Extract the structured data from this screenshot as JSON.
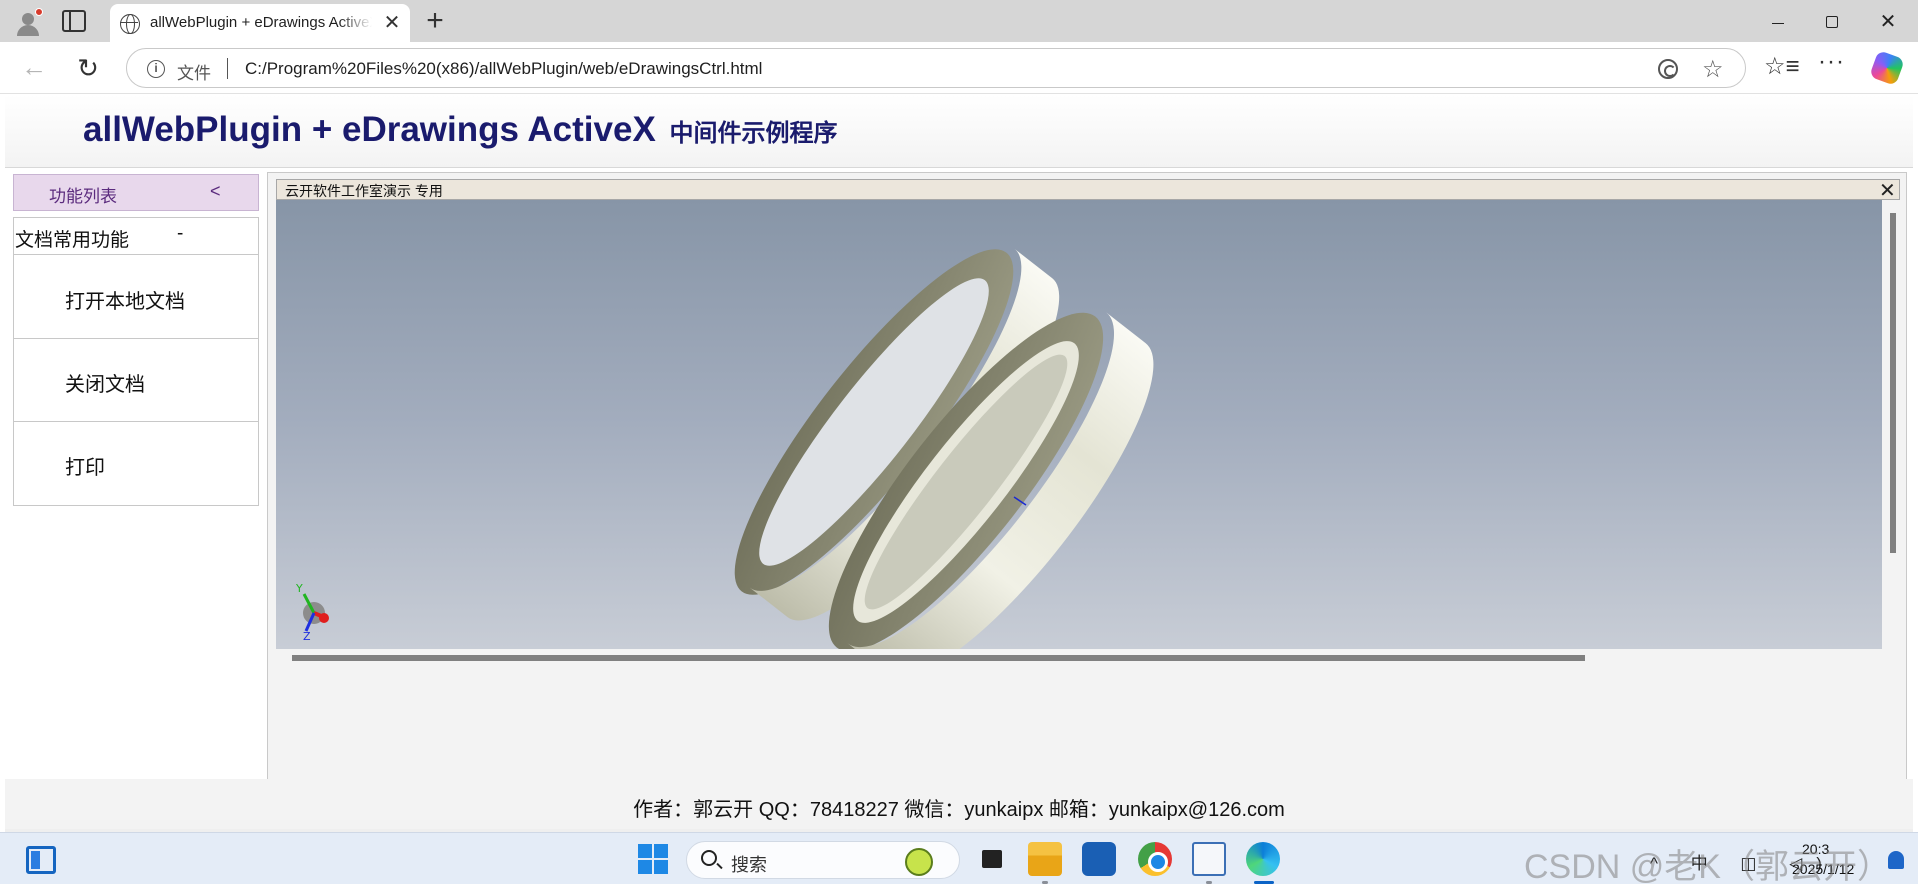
{
  "browser": {
    "tab_title": "allWebPlugin + eDrawings ActiveX",
    "tab_close": "✕",
    "new_tab": "+",
    "window": {
      "close": "✕"
    },
    "site_info_label": "文件",
    "url": "C:/Program%20Files%20(x86)/allWebPlugin/web/eDrawingsCtrl.html",
    "icons": [
      "back-arrow-icon",
      "reload-icon",
      "info-icon",
      "read-aloud-icon",
      "star-icon",
      "favorites-icon",
      "more-icon",
      "copilot-icon"
    ],
    "glyphs": {
      "back": "←",
      "reload": "↻",
      "info": "i",
      "star": "☆",
      "favorites": "☆≡",
      "menu": "···"
    }
  },
  "page": {
    "title": "allWebPlugin + eDrawings ActiveX",
    "subtitle": "中间件示例程序",
    "sidebar": {
      "title": "功能列表",
      "collapse_symbol": "<",
      "group": {
        "title": "文档常用功能",
        "toggle_symbol": "-",
        "items": [
          {
            "label": "打开本地文档"
          },
          {
            "label": "关闭文档"
          },
          {
            "label": "打印"
          }
        ]
      }
    },
    "plugin": {
      "window_title": "云开软件工作室演示  专用",
      "close_symbol": "✕",
      "axis_labels": {
        "y": "Y",
        "z": "Z"
      },
      "colors": {
        "viewport_top": "#8795a7",
        "viewport_bottom": "#c8cdd6",
        "ring": "#e6e6d8"
      }
    },
    "footer": "作者：郭云开 QQ：78418227 微信：yunkaipx 邮箱：yunkaipx@126.com"
  },
  "taskbar": {
    "search_label": "搜索",
    "clock_time": "20:3",
    "clock_date": "2025/1/12",
    "tray_icons": "^ 中 ◫ ◁)",
    "watermark": "CSDN @老K（郭云开）",
    "apps": [
      "task-view",
      "file-explorer",
      "microsoft-store",
      "chrome",
      "resource-monitor",
      "edge"
    ]
  }
}
